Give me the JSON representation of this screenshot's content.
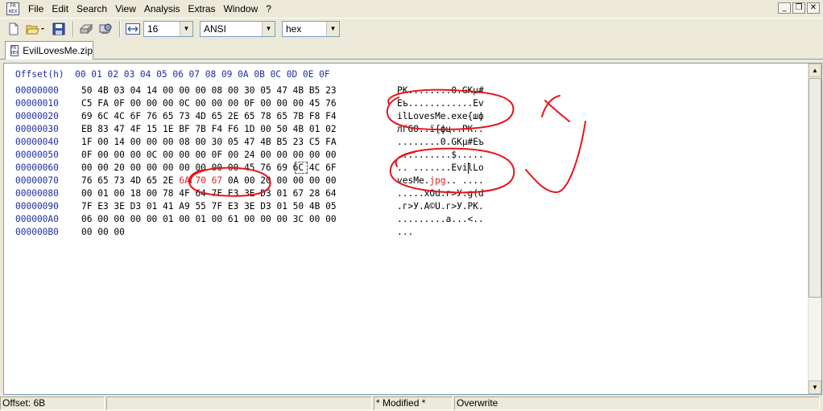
{
  "menu": {
    "items": [
      "File",
      "Edit",
      "Search",
      "View",
      "Analysis",
      "Extras",
      "Window",
      "?"
    ]
  },
  "window_controls": {
    "minimize": "_",
    "restore": "❐",
    "close": "✕"
  },
  "toolbar": {
    "bytes_per_row": "16",
    "charset": "ANSI",
    "display_mode": "hex",
    "icons": [
      "new-file-icon",
      "open-folder-icon",
      "save-icon",
      "print-icon",
      "properties-icon",
      "byte-width-icon"
    ]
  },
  "tab": {
    "title": "EvilLovesMe.zip"
  },
  "hex_header": "Offset(h)  00 01 02 03 04 05 06 07 08 09 0A 0B 0C 0D 0E 0F",
  "rows": [
    {
      "offset": "00000000",
      "hex": "50 4B 03 04 14 00 00 00 08 00 30 05 47 4B B5 23",
      "ascii": "PK........0.GKµ#"
    },
    {
      "offset": "00000010",
      "hex": "C5 FA 0F 00 00 00 0C 00 00 00 0F 00 00 00 45 76",
      "ascii": "Еъ............Ev"
    },
    {
      "offset": "00000020",
      "hex": "69 6C 4C 6F 76 65 73 4D 65 2E 65 78 65 7B F8 F4",
      "ascii": "ilLovesMe.exe{шф"
    },
    {
      "offset": "00000030",
      "hex": "EB 83 47 4F 15 1E BF 7B F4 F6 1D 00 50 4B 01 02",
      "ascii": "лѓGO..ї{фц..PK.."
    },
    {
      "offset": "00000040",
      "hex": "1F 00 14 00 00 00 08 00 30 05 47 4B B5 23 C5 FA",
      "ascii": "........0.GKµ#Еъ"
    },
    {
      "offset": "00000050",
      "hex": "0F 00 00 00 0C 00 00 00 0F 00 24 00 00 00 00 00",
      "ascii": "..........$....."
    },
    {
      "offset": "00000060",
      "hex": "00 00 20 00 00 00 00 00 00 00 45 76 69 6C 4C 6F",
      "ascii": ".. .......EvilLo"
    },
    {
      "offset": "00000070",
      "hex_pre": "76 65 73 4D 65 2E ",
      "hex_hl": "6A 70 67",
      "hex_post": " 0A 00 20 00 00 00 00",
      "ascii_pre": "vesMe.",
      "ascii_hl": "jpg",
      "ascii_post": ".. ...."
    },
    {
      "offset": "00000080",
      "hex": "00 01 00 18 00 78 4F 64 7F E3 3E D3 01 67 28 64",
      "ascii": ".....xOd.г>У.g(d"
    },
    {
      "offset": "00000090",
      "hex": "7F E3 3E D3 01 41 A9 55 7F E3 3E D3 01 50 4B 05",
      "ascii": ".г>У.A©U.г>У.PK."
    },
    {
      "offset": "000000A0",
      "hex": "06 00 00 00 00 01 00 01 00 61 00 00 00 3C 00 00",
      "ascii": ".........a...<.."
    },
    {
      "offset": "000000B0",
      "hex": "00 00 00",
      "ascii": "..."
    }
  ],
  "status": {
    "offset": "Offset: 6B",
    "modified": "* Modified *",
    "mode": "Overwrite"
  },
  "colors": {
    "offset_blue": "#1c2ea8",
    "highlight_red": "#e02020",
    "annotation_red": "#e8141c"
  }
}
